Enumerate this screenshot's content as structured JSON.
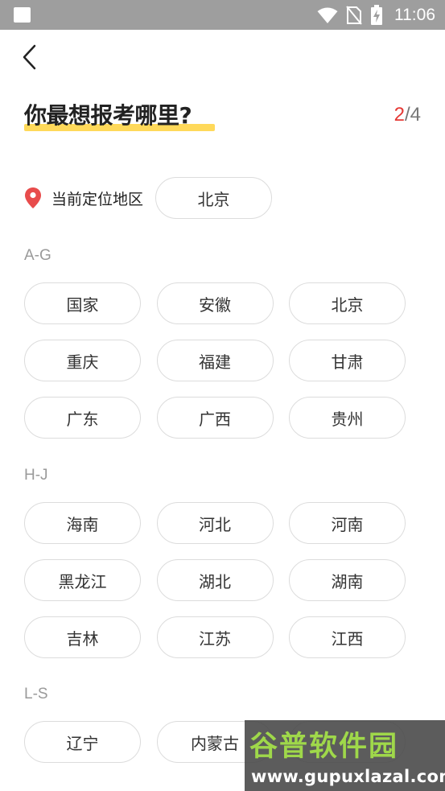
{
  "status_bar": {
    "time": "11:06"
  },
  "header": {
    "title": "你最想报考哪里?",
    "step_current": "2",
    "step_total": "/4"
  },
  "location": {
    "label": "当前定位地区",
    "value": "北京"
  },
  "sections": [
    {
      "letter": "A-G",
      "items": [
        "国家",
        "安徽",
        "北京",
        "重庆",
        "福建",
        "甘肃",
        "广东",
        "广西",
        "贵州"
      ]
    },
    {
      "letter": "H-J",
      "items": [
        "海南",
        "河北",
        "河南",
        "黑龙江",
        "湖北",
        "湖南",
        "吉林",
        "江苏",
        "江西"
      ]
    },
    {
      "letter": "L-S",
      "items": [
        "辽宁",
        "内蒙古"
      ]
    }
  ],
  "watermark": {
    "brand": "谷普软件园",
    "url": "www.gupuxlazal.com"
  },
  "colors": {
    "accent_red": "#e53935",
    "highlight_yellow": "#ffd95a",
    "pin_red": "#e84c4c"
  }
}
